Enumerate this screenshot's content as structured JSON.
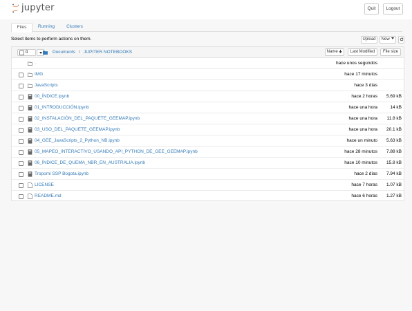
{
  "header": {
    "logo_text": "jupyter",
    "quit_label": "Quit",
    "logout_label": "Logout"
  },
  "tabs": [
    {
      "label": "Files",
      "active": true
    },
    {
      "label": "Running",
      "active": false
    },
    {
      "label": "Clusters",
      "active": false
    }
  ],
  "toolbar": {
    "instruction": "Select items to perform actions on them.",
    "upload_label": "Upload",
    "new_label": "New",
    "refresh_icon": "refresh-icon"
  },
  "list_header": {
    "selected_count": "0",
    "breadcrumb": [
      "Documents",
      "JUPITER NOTEBOOKS"
    ],
    "breadcrumb_separator": "/",
    "sort_name_label": "Name",
    "sort_modified_label": "Last Modified",
    "sort_size_label": "File size"
  },
  "rows": [
    {
      "type": "updir",
      "name": "..",
      "modified": "hace unos segundos",
      "size": ""
    },
    {
      "type": "folder",
      "name": "IMG",
      "modified": "hace 17 minutos",
      "size": ""
    },
    {
      "type": "folder",
      "name": "JavaScripts",
      "modified": "hace 3 días",
      "size": ""
    },
    {
      "type": "notebook",
      "name": "00_ÍNDICE.ipynb",
      "modified": "hace 2 horas",
      "size": "5.69 kB"
    },
    {
      "type": "notebook",
      "name": "01_INTRODUCCIÓN.ipynb",
      "modified": "hace una hora",
      "size": "14 kB"
    },
    {
      "type": "notebook",
      "name": "02_INSTALACIÓN_DEL_PAQUETE_GEEMAP.ipynb",
      "modified": "hace una hora",
      "size": "11.8 kB"
    },
    {
      "type": "notebook",
      "name": "03_USO_DEL_PAQUETE_GEEMAP.ipynb",
      "modified": "hace una hora",
      "size": "20.1 kB"
    },
    {
      "type": "notebook",
      "name": "04_GEE_JavaScripts_2_Python_NB.ipynb",
      "modified": "hace un minuto",
      "size": "5.63 kB"
    },
    {
      "type": "notebook",
      "name": "05_MAPEO_INTERACTIVO_USANDO_API_PYTHON_DE_GEE_GEEMAP.ipynb",
      "modified": "hace 28 minutos",
      "size": "7.88 kB"
    },
    {
      "type": "notebook",
      "name": "06_ÍNDICE_DE_QUEMA_NBR_EN_AUSTRALIA.ipynb",
      "modified": "hace 10 minutos",
      "size": "15.8 kB"
    },
    {
      "type": "notebook",
      "name": "Tropomi SSP Bogota.ipynb",
      "modified": "hace 2 días",
      "size": "7.94 kB"
    },
    {
      "type": "file",
      "name": "LICENSE",
      "modified": "hace 7 horas",
      "size": "1.07 kB"
    },
    {
      "type": "file",
      "name": "README.md",
      "modified": "hace 6 horas",
      "size": "1.27 kB"
    }
  ],
  "colors": {
    "link": "#337ab7",
    "logo_orange": "#f37726",
    "folder_icon": "#777777"
  }
}
